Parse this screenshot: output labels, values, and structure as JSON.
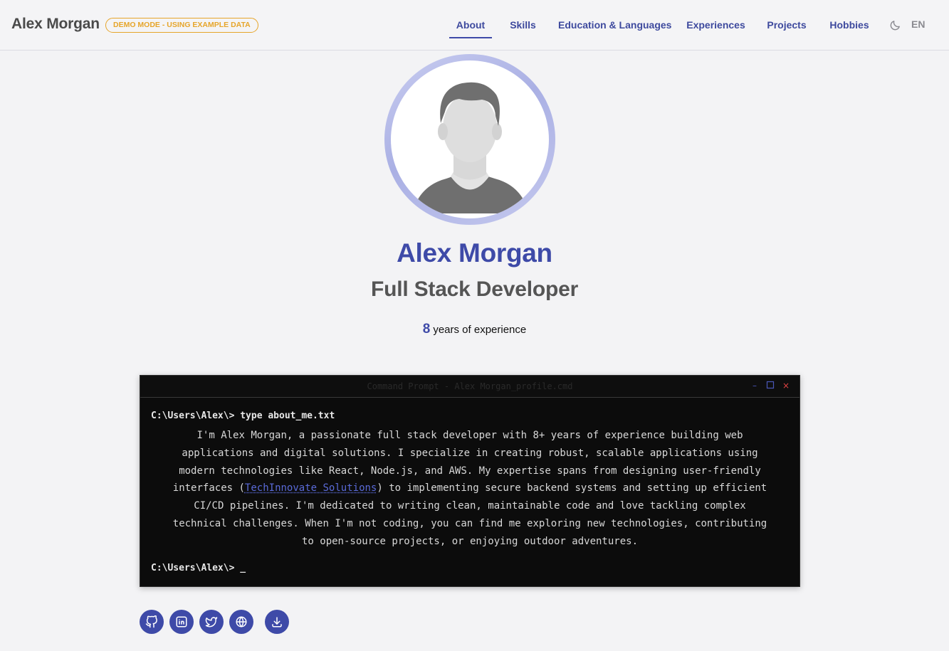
{
  "header": {
    "brand": "Alex Morgan",
    "demo_badge": "DEMO MODE - USING EXAMPLE DATA",
    "nav": [
      {
        "label": "About",
        "active": true
      },
      {
        "label": "Skills"
      },
      {
        "label": "Education & Languages"
      },
      {
        "label": "Experiences"
      },
      {
        "label": "Projects"
      },
      {
        "label": "Hobbies"
      }
    ],
    "theme_icon": "moon-icon",
    "language": "EN"
  },
  "profile": {
    "avatar_icon": "person-avatar-icon",
    "name": "Alex Morgan",
    "role": "Full Stack Developer",
    "years": "8",
    "years_label": "years of experience"
  },
  "terminal": {
    "title": "Command Prompt - Alex Morgan_profile.cmd",
    "command_line": "C:\\Users\\Alex\\> type about_me.txt",
    "lines": [
      "I'm Alex Morgan, a passionate full stack developer with 8+ years of experience building web",
      "applications and digital solutions. I specialize in creating robust, scalable applications using",
      "modern technologies like React, Node.js, and AWS. My expertise spans from designing user-friendly"
    ],
    "line4_before": "interfaces (",
    "link_text": "TechInnovate Solutions",
    "line4_after": ") to implementing secure backend systems and setting up efficient",
    "lines_rest": [
      "CI/CD pipelines. I'm dedicated to writing clean, maintainable code and love tackling complex",
      "technical challenges. When I'm not coding, you can find me exploring new technologies, contributing",
      "to open-source projects, or enjoying outdoor adventures."
    ],
    "final_prompt": "C:\\Users\\Alex\\> _",
    "window_buttons": [
      "minimize-icon",
      "maximize-icon",
      "close-icon"
    ]
  },
  "social": [
    "github-icon",
    "linkedin-icon",
    "twitter-icon",
    "globe-icon",
    "download-icon"
  ],
  "colors": {
    "accent": "#3e4aa8",
    "badge": "#e6a52a",
    "terminal_bg": "#0c0c0c",
    "link": "#5a6ad8"
  }
}
